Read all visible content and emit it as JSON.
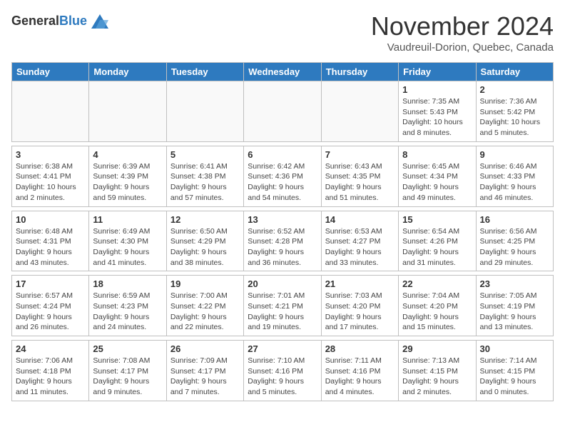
{
  "header": {
    "logo_general": "General",
    "logo_blue": "Blue",
    "month_title": "November 2024",
    "location": "Vaudreuil-Dorion, Quebec, Canada"
  },
  "weekdays": [
    "Sunday",
    "Monday",
    "Tuesday",
    "Wednesday",
    "Thursday",
    "Friday",
    "Saturday"
  ],
  "weeks": [
    [
      {
        "day": "",
        "info": ""
      },
      {
        "day": "",
        "info": ""
      },
      {
        "day": "",
        "info": ""
      },
      {
        "day": "",
        "info": ""
      },
      {
        "day": "",
        "info": ""
      },
      {
        "day": "1",
        "info": "Sunrise: 7:35 AM\nSunset: 5:43 PM\nDaylight: 10 hours and 8 minutes."
      },
      {
        "day": "2",
        "info": "Sunrise: 7:36 AM\nSunset: 5:42 PM\nDaylight: 10 hours and 5 minutes."
      }
    ],
    [
      {
        "day": "3",
        "info": "Sunrise: 6:38 AM\nSunset: 4:41 PM\nDaylight: 10 hours and 2 minutes."
      },
      {
        "day": "4",
        "info": "Sunrise: 6:39 AM\nSunset: 4:39 PM\nDaylight: 9 hours and 59 minutes."
      },
      {
        "day": "5",
        "info": "Sunrise: 6:41 AM\nSunset: 4:38 PM\nDaylight: 9 hours and 57 minutes."
      },
      {
        "day": "6",
        "info": "Sunrise: 6:42 AM\nSunset: 4:36 PM\nDaylight: 9 hours and 54 minutes."
      },
      {
        "day": "7",
        "info": "Sunrise: 6:43 AM\nSunset: 4:35 PM\nDaylight: 9 hours and 51 minutes."
      },
      {
        "day": "8",
        "info": "Sunrise: 6:45 AM\nSunset: 4:34 PM\nDaylight: 9 hours and 49 minutes."
      },
      {
        "day": "9",
        "info": "Sunrise: 6:46 AM\nSunset: 4:33 PM\nDaylight: 9 hours and 46 minutes."
      }
    ],
    [
      {
        "day": "10",
        "info": "Sunrise: 6:48 AM\nSunset: 4:31 PM\nDaylight: 9 hours and 43 minutes."
      },
      {
        "day": "11",
        "info": "Sunrise: 6:49 AM\nSunset: 4:30 PM\nDaylight: 9 hours and 41 minutes."
      },
      {
        "day": "12",
        "info": "Sunrise: 6:50 AM\nSunset: 4:29 PM\nDaylight: 9 hours and 38 minutes."
      },
      {
        "day": "13",
        "info": "Sunrise: 6:52 AM\nSunset: 4:28 PM\nDaylight: 9 hours and 36 minutes."
      },
      {
        "day": "14",
        "info": "Sunrise: 6:53 AM\nSunset: 4:27 PM\nDaylight: 9 hours and 33 minutes."
      },
      {
        "day": "15",
        "info": "Sunrise: 6:54 AM\nSunset: 4:26 PM\nDaylight: 9 hours and 31 minutes."
      },
      {
        "day": "16",
        "info": "Sunrise: 6:56 AM\nSunset: 4:25 PM\nDaylight: 9 hours and 29 minutes."
      }
    ],
    [
      {
        "day": "17",
        "info": "Sunrise: 6:57 AM\nSunset: 4:24 PM\nDaylight: 9 hours and 26 minutes."
      },
      {
        "day": "18",
        "info": "Sunrise: 6:59 AM\nSunset: 4:23 PM\nDaylight: 9 hours and 24 minutes."
      },
      {
        "day": "19",
        "info": "Sunrise: 7:00 AM\nSunset: 4:22 PM\nDaylight: 9 hours and 22 minutes."
      },
      {
        "day": "20",
        "info": "Sunrise: 7:01 AM\nSunset: 4:21 PM\nDaylight: 9 hours and 19 minutes."
      },
      {
        "day": "21",
        "info": "Sunrise: 7:03 AM\nSunset: 4:20 PM\nDaylight: 9 hours and 17 minutes."
      },
      {
        "day": "22",
        "info": "Sunrise: 7:04 AM\nSunset: 4:20 PM\nDaylight: 9 hours and 15 minutes."
      },
      {
        "day": "23",
        "info": "Sunrise: 7:05 AM\nSunset: 4:19 PM\nDaylight: 9 hours and 13 minutes."
      }
    ],
    [
      {
        "day": "24",
        "info": "Sunrise: 7:06 AM\nSunset: 4:18 PM\nDaylight: 9 hours and 11 minutes."
      },
      {
        "day": "25",
        "info": "Sunrise: 7:08 AM\nSunset: 4:17 PM\nDaylight: 9 hours and 9 minutes."
      },
      {
        "day": "26",
        "info": "Sunrise: 7:09 AM\nSunset: 4:17 PM\nDaylight: 9 hours and 7 minutes."
      },
      {
        "day": "27",
        "info": "Sunrise: 7:10 AM\nSunset: 4:16 PM\nDaylight: 9 hours and 5 minutes."
      },
      {
        "day": "28",
        "info": "Sunrise: 7:11 AM\nSunset: 4:16 PM\nDaylight: 9 hours and 4 minutes."
      },
      {
        "day": "29",
        "info": "Sunrise: 7:13 AM\nSunset: 4:15 PM\nDaylight: 9 hours and 2 minutes."
      },
      {
        "day": "30",
        "info": "Sunrise: 7:14 AM\nSunset: 4:15 PM\nDaylight: 9 hours and 0 minutes."
      }
    ]
  ]
}
